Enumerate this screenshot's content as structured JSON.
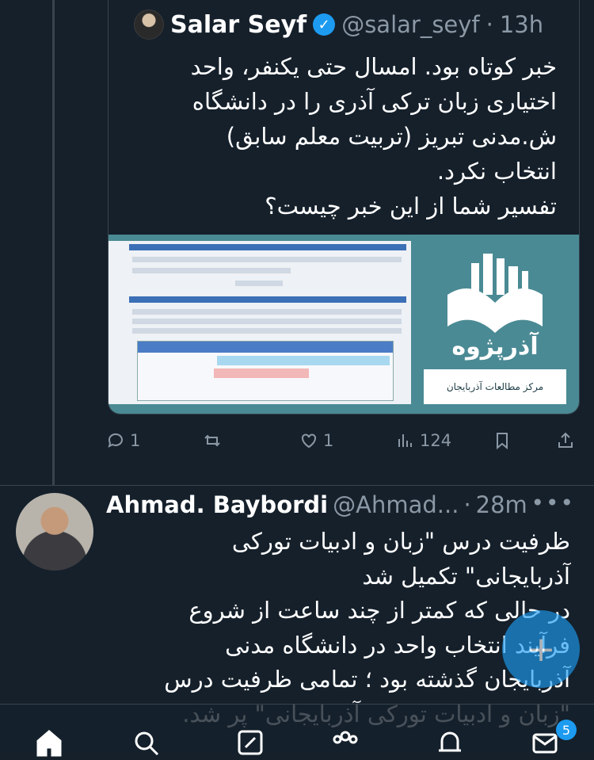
{
  "quoted": {
    "name": "Salar Seyf",
    "handle": "@salar_seyf",
    "separator": "·",
    "time": "13h",
    "text": "خبر کوتاه بود. امسال حتی یکنفر، واحد\nاختیاری زبان ترکی آذری را در دانشگاه\nش.مدنی تبریز (تربیت معلم سابق)\nانتخاب نکرد.\nتفسیر شما از این خبر چیست؟",
    "image": {
      "logo_title": "آذرپژوه",
      "logo_subtitle": "مرکز مطالعات آذربایجان"
    }
  },
  "actions": {
    "replies": "1",
    "retweets": "",
    "likes": "1",
    "views": "124"
  },
  "reply": {
    "name": "Ahmad. Baybordi",
    "handle": "@Ahmad...",
    "separator": "·",
    "time": "28m",
    "more": "•••",
    "text": "ظرفیت درس \"زبان و ادبیات تورکی\nآذربایجانی\" تکمیل شد\nدر حالی که کمتر از چند ساعت از شروع\nفرآیند انتخاب واحد در دانشگاه مدنی\nآذربایجان گذشته بود ؛ تمامی ظرفیت درس\n\"زبان و ادبیات تورکی آذربایجانی\" پر شد."
  },
  "fab": {
    "icon": "plus-icon",
    "label": "+"
  },
  "bottom_nav": {
    "items": [
      "home-icon",
      "search-icon",
      "compose-icon",
      "communities-icon",
      "notifications-icon",
      "messages-icon"
    ],
    "messages_badge": "5"
  },
  "colors": {
    "background": "#15202b",
    "accent": "#1d9bf0",
    "muted": "#8b98a5",
    "border": "#38444d"
  }
}
